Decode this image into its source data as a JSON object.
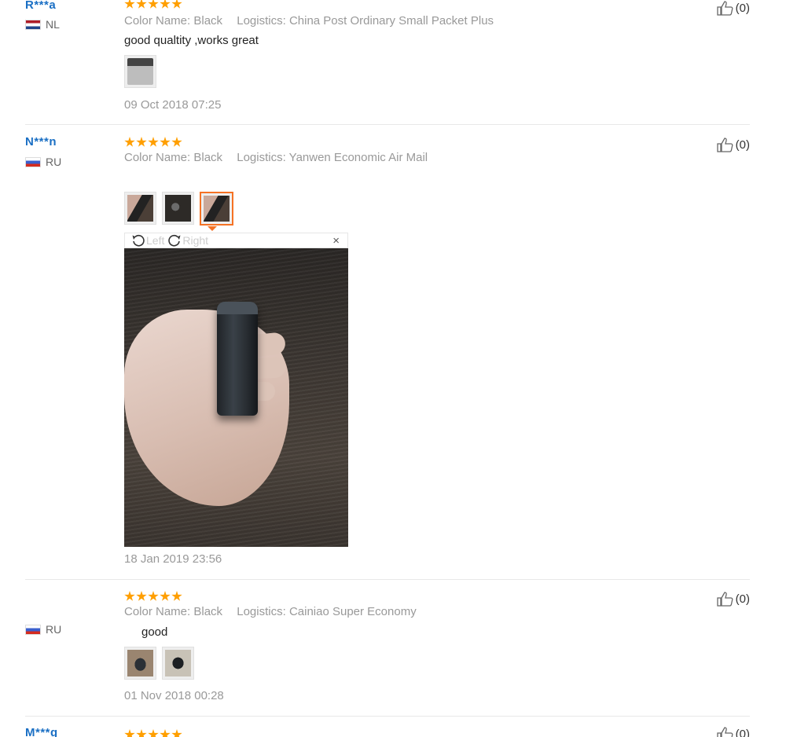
{
  "reviews": [
    {
      "user": "R***a",
      "country": "NL",
      "rating": 5,
      "color_key": "Color Name:",
      "color_val": "Black",
      "logistics_key": "Logistics:",
      "logistics_val": "China Post Ordinary Small Packet Plus",
      "text": "good qualtity ,works great",
      "date": "09 Oct 2018 07:25",
      "likes": "(0)"
    },
    {
      "user": "N***n",
      "country": "RU",
      "rating": 5,
      "color_key": "Color Name:",
      "color_val": "Black",
      "logistics_key": "Logistics:",
      "logistics_val": "Yanwen Economic Air Mail",
      "text": "",
      "date": "18 Jan 2019 23:56",
      "likes": "(0)",
      "viewer": {
        "rotate_left": "Left",
        "rotate_right": "Right",
        "close": "×"
      }
    },
    {
      "user": "",
      "country": "RU",
      "rating": 5,
      "color_key": "Color Name:",
      "color_val": "Black",
      "logistics_key": "Logistics:",
      "logistics_val": "Cainiao Super Economy",
      "text": "good",
      "date": "01 Nov 2018 00:28",
      "likes": "(0)"
    },
    {
      "user": "M***g",
      "country": "",
      "rating": 5,
      "likes": "(0)"
    }
  ],
  "colors": {
    "accent": "#f57224",
    "star": "#ff9f00",
    "link": "#1a6fc4"
  }
}
